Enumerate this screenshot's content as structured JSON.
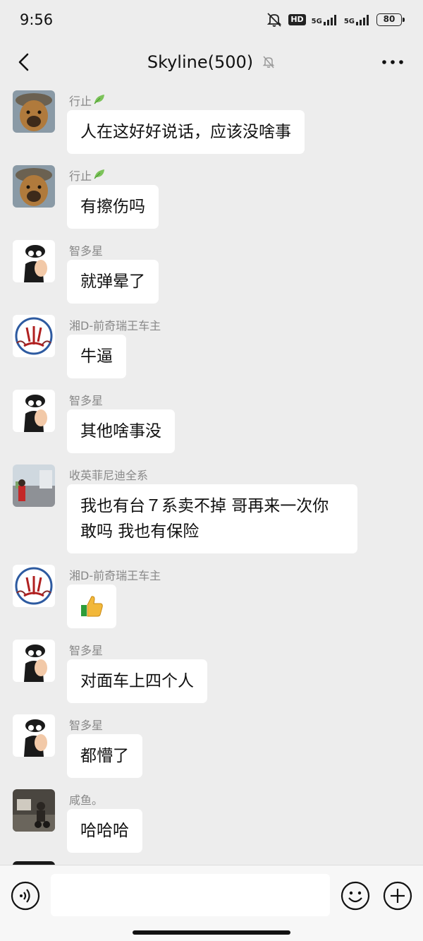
{
  "status": {
    "time": "9:56",
    "hd_label": "HD",
    "net1": "5G",
    "net2": "5G",
    "battery": "80"
  },
  "header": {
    "title": "Skyline(500)"
  },
  "messages": [
    {
      "sender": "行止",
      "text": "人在这好好说话，应该没啥事",
      "leaf": true,
      "avatar": "dog-avatar"
    },
    {
      "sender": "行止",
      "text": "有擦伤吗",
      "leaf": true,
      "avatar": "dog-avatar"
    },
    {
      "sender": "智多星",
      "text": "就弹晕了",
      "avatar": "sketch-man-avatar"
    },
    {
      "sender": "湘D-前奇瑞王车主",
      "text": "牛逼",
      "avatar": "seal-logo-avatar"
    },
    {
      "sender": "智多星",
      "text": "其他啥事没",
      "avatar": "sketch-man-avatar"
    },
    {
      "sender": "收英菲尼迪全系",
      "text": "我也有台７系卖不掉 哥再来一次你敢吗 我也有保险",
      "avatar": "street-photo-avatar"
    },
    {
      "sender": "湘D-前奇瑞王车主",
      "emoji": "thumbs-up-emoji",
      "avatar": "seal-logo-avatar"
    },
    {
      "sender": "智多星",
      "text": "对面车上四个人",
      "avatar": "sketch-man-avatar"
    },
    {
      "sender": "智多星",
      "text": "都懵了",
      "avatar": "sketch-man-avatar"
    },
    {
      "sender": "咸鱼。",
      "text": "哈哈哈",
      "avatar": "motorbike-photo-avatar"
    }
  ],
  "input": {
    "value": "",
    "placeholder": ""
  }
}
